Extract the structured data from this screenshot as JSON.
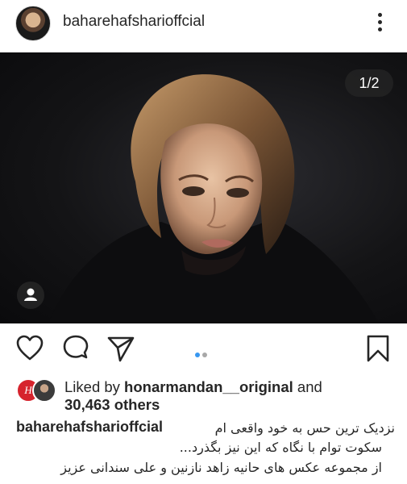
{
  "post": {
    "username": "baharehafsharioffcial",
    "counter": "1/2",
    "slide_count": 2,
    "active_slide": 1
  },
  "icons": {
    "more": "more-vertical-icon",
    "tag": "user-tag-icon",
    "like": "heart-icon",
    "comment": "comment-icon",
    "share": "paper-plane-icon",
    "save": "bookmark-icon"
  },
  "likes": {
    "liked_by_prefix": "Liked by",
    "liked_by_user": "honarmandan__original",
    "and_text": "and",
    "others": "30,463 others"
  },
  "caption": {
    "username": "baharehafsharioffcial",
    "line1": "نزدیک ترین حس به خود واقعی ام",
    "line2": "سکوت توام با نگاه که این نیز بگذرد...",
    "line3": "از مجموعه عکس های حانیه زاهد نازنین و علی سندانی عزیز"
  },
  "colors": {
    "text": "#262626",
    "dot_active": "#3897f0",
    "dot_inactive": "#a8a8a8",
    "brand_badge": "#d6232d"
  }
}
